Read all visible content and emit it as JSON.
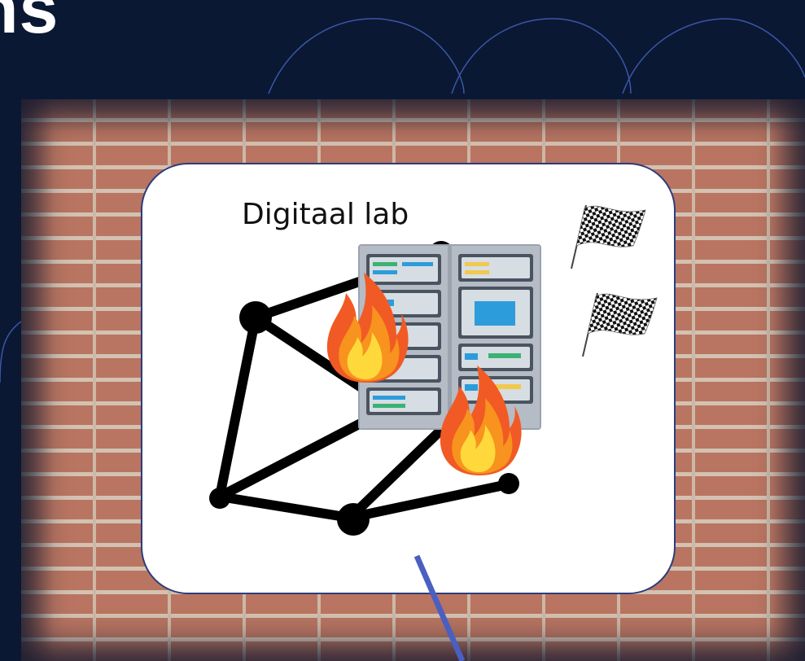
{
  "slide": {
    "heading_fragment": "ns",
    "background_color": "#0a1833"
  },
  "card": {
    "title": "Digitaal lab"
  },
  "icons": {
    "network": "network-graph-icon",
    "server": "server-rack-icon",
    "fire": "fire-icon",
    "flag": "checkered-flag-icon"
  },
  "colors": {
    "node": "#000000",
    "connector": "#4a5fc1",
    "card_border": "#2c3c7a",
    "brick": "#b97561"
  }
}
